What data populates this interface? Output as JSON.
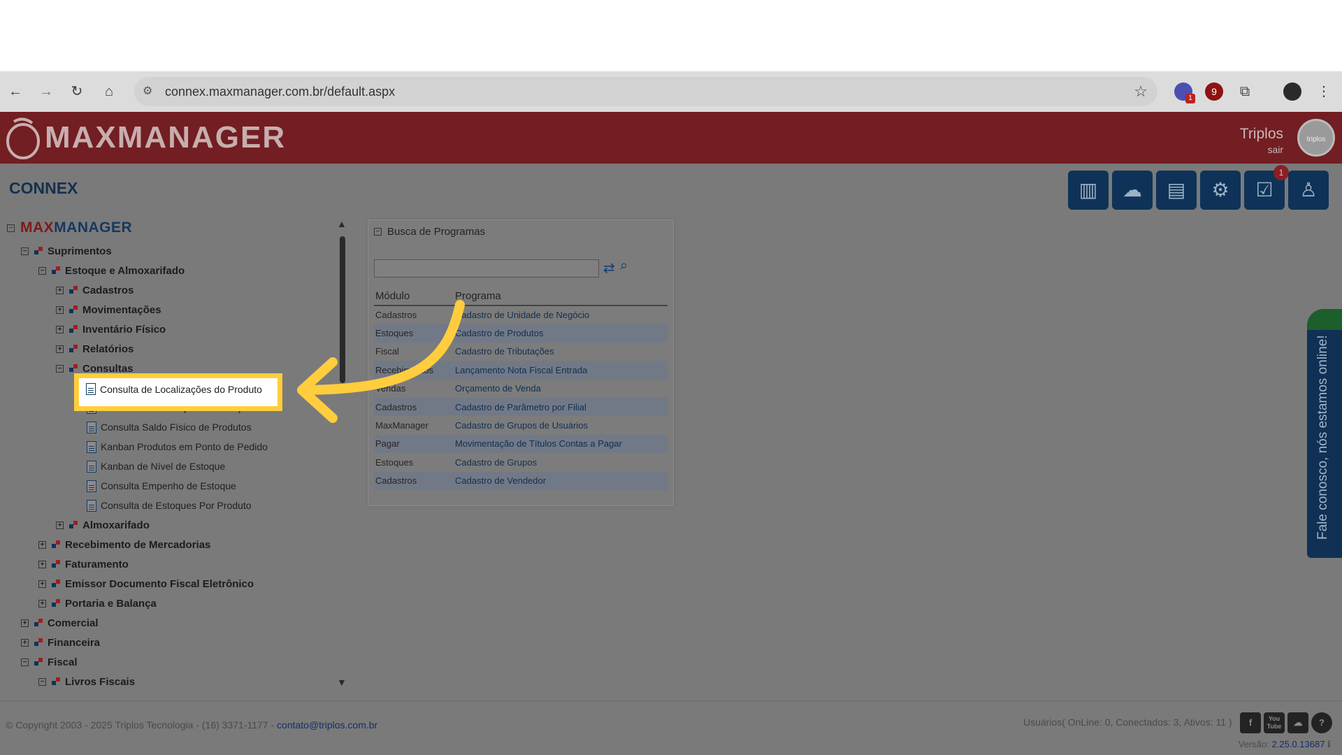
{
  "browser": {
    "url": "connex.maxmanager.com.br/default.aspx",
    "ext_badge": "1",
    "ext2_label": "9"
  },
  "header": {
    "logo": "MAXMANAGER",
    "user_name": "Triplos",
    "logout": "sair",
    "avatar_text": "triplos"
  },
  "subheader": {
    "title": "CONNEX",
    "notification_count": "1"
  },
  "tree": {
    "brand_prefix": "MAX",
    "brand_suffix": "MANAGER",
    "items": [
      {
        "label": "Suprimentos",
        "toggle": "−"
      },
      {
        "label": "Estoque e Almoxarifado",
        "toggle": "−"
      },
      {
        "label": "Cadastros",
        "toggle": "+"
      },
      {
        "label": "Movimentações",
        "toggle": "+"
      },
      {
        "label": "Inventário Físico",
        "toggle": "+"
      },
      {
        "label": "Relatórios",
        "toggle": "+"
      },
      {
        "label": "Consultas",
        "toggle": "−"
      },
      {
        "label": "Almoxarifado",
        "toggle": "+"
      },
      {
        "label": "Recebimento de Mercadorias",
        "toggle": "+"
      },
      {
        "label": "Faturamento",
        "toggle": "+"
      },
      {
        "label": "Emissor Documento Fiscal Eletrônico",
        "toggle": "+"
      },
      {
        "label": "Portaria e Balança",
        "toggle": "+"
      },
      {
        "label": "Comercial",
        "toggle": "+"
      },
      {
        "label": "Financeira",
        "toggle": "+"
      },
      {
        "label": "Fiscal",
        "toggle": "−"
      },
      {
        "label": "Livros Fiscais",
        "toggle": "−"
      }
    ],
    "leaves": [
      "Consulta de Localizações do Produto",
      "Consulta Produtos por Localização",
      "Consulta Saldo Físico de Produtos",
      "Kanban Produtos em Ponto de Pedido",
      "Kanban de Nível de Estoque",
      "Consulta Empenho de Estoque",
      "Consulta de Estoques Por Produto"
    ]
  },
  "busca": {
    "title": "Busca de Programas",
    "search_value": "",
    "col_modulo": "Módulo",
    "col_programa": "Programa",
    "rows": [
      {
        "modulo": "Cadastros",
        "programa": "Cadastro de Unidade de Negócio"
      },
      {
        "modulo": "Estoques",
        "programa": "Cadastro de Produtos"
      },
      {
        "modulo": "Fiscal",
        "programa": "Cadastro de Tributações"
      },
      {
        "modulo": "Recebimentos",
        "programa": "Lançamento Nota Fiscal Entrada"
      },
      {
        "modulo": "Vendas",
        "programa": "Orçamento de Venda"
      },
      {
        "modulo": "Cadastros",
        "programa": "Cadastro de Parâmetro por Filial"
      },
      {
        "modulo": "MaxManager",
        "programa": "Cadastro de Grupos de Usuários"
      },
      {
        "modulo": "Pagar",
        "programa": "Movimentação de Títulos Contas a Pagar"
      },
      {
        "modulo": "Estoques",
        "programa": "Cadastro de Grupos"
      },
      {
        "modulo": "Cadastros",
        "programa": "Cadastro de Vendedor"
      }
    ]
  },
  "chat_tab": {
    "label": "Fale conosco, nós estamos online!"
  },
  "footer": {
    "copyright": "© Copyright 2003 - 2025 Triplos Tecnologia - (16) 3371-1177 - ",
    "email": "contato@triplos.com.br",
    "usuarios": "Usuários( OnLine: 0, Conectados: 3, Ativos: 11 )",
    "versao_label": "Versão:",
    "versao": "2.25.0.13687",
    "social_youtube": "You Tube"
  },
  "colors": {
    "header_red": "#721e22",
    "highlight_yellow": "#ffcd3d",
    "navy": "#0f3358"
  }
}
